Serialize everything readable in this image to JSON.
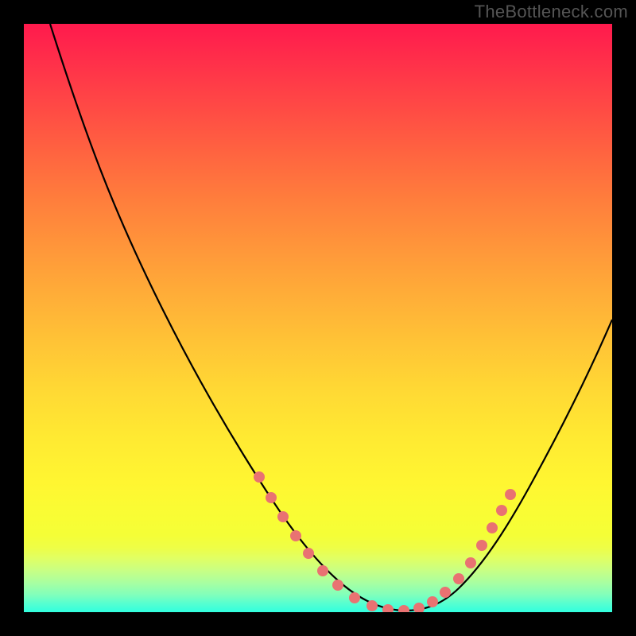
{
  "watermark": "TheBottleneck.com",
  "chart_data": {
    "type": "line",
    "title": "",
    "xlabel": "",
    "ylabel": "",
    "xlim": [
      0,
      100
    ],
    "ylim": [
      0,
      100
    ],
    "grid": false,
    "legend": false,
    "series": [
      {
        "name": "bottleneck-curve",
        "x": [
          5,
          8,
          12,
          16,
          20,
          24,
          28,
          32,
          36,
          40,
          44,
          48,
          52,
          56,
          60,
          64,
          68,
          72,
          76,
          80,
          84,
          88,
          92,
          96,
          100
        ],
        "y": [
          100,
          93,
          85,
          77,
          69,
          60,
          52,
          44,
          35,
          27,
          19,
          12,
          6,
          2,
          0,
          0,
          2,
          6,
          12,
          20,
          28,
          36,
          44,
          51,
          58
        ]
      }
    ],
    "markers": {
      "name": "highlight-points",
      "color": "#e97272",
      "x": [
        40,
        42,
        44.5,
        47,
        49.5,
        53,
        57,
        60,
        62.5,
        65,
        68,
        70.5,
        73,
        75,
        77
      ],
      "y": [
        27,
        23,
        18,
        14,
        10,
        5,
        2,
        0,
        0,
        0,
        2,
        5,
        9,
        13,
        18
      ]
    },
    "gradient_bands": [
      {
        "position": 0,
        "color": "#ff1a4d"
      },
      {
        "position": 50,
        "color": "#ffb837"
      },
      {
        "position": 80,
        "color": "#fff631"
      },
      {
        "position": 100,
        "color": "#31ffdf"
      }
    ]
  }
}
